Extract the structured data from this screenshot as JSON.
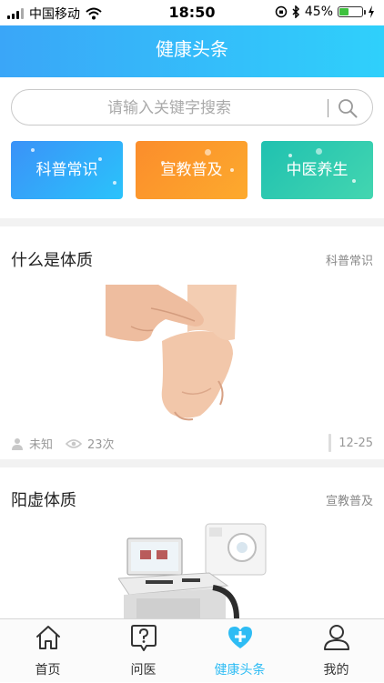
{
  "status_bar": {
    "carrier": "中国移动",
    "time": "18:50",
    "battery": "45%",
    "battery_level": 0.45
  },
  "header": {
    "title": "健康头条"
  },
  "search": {
    "placeholder": "请输入关键字搜索"
  },
  "categories": [
    {
      "label": "科普常识",
      "color": "#3b92f8"
    },
    {
      "label": "宣教普及",
      "color": "#fb8d2c"
    },
    {
      "label": "中医养生",
      "color": "#20c1b0"
    }
  ],
  "articles": [
    {
      "title": "什么是体质",
      "tag": "科普常识",
      "author": "未知",
      "views": "23次",
      "date": "12-25"
    },
    {
      "title": "阳虚体质",
      "tag": "宣教普及"
    }
  ],
  "tabbar": {
    "active_color": "#2ebcf4",
    "items": [
      {
        "label": "首页",
        "icon": "home-icon"
      },
      {
        "label": "问医",
        "icon": "question-icon"
      },
      {
        "label": "健康头条",
        "icon": "heart-plus-icon"
      },
      {
        "label": "我的",
        "icon": "user-icon"
      }
    ]
  }
}
